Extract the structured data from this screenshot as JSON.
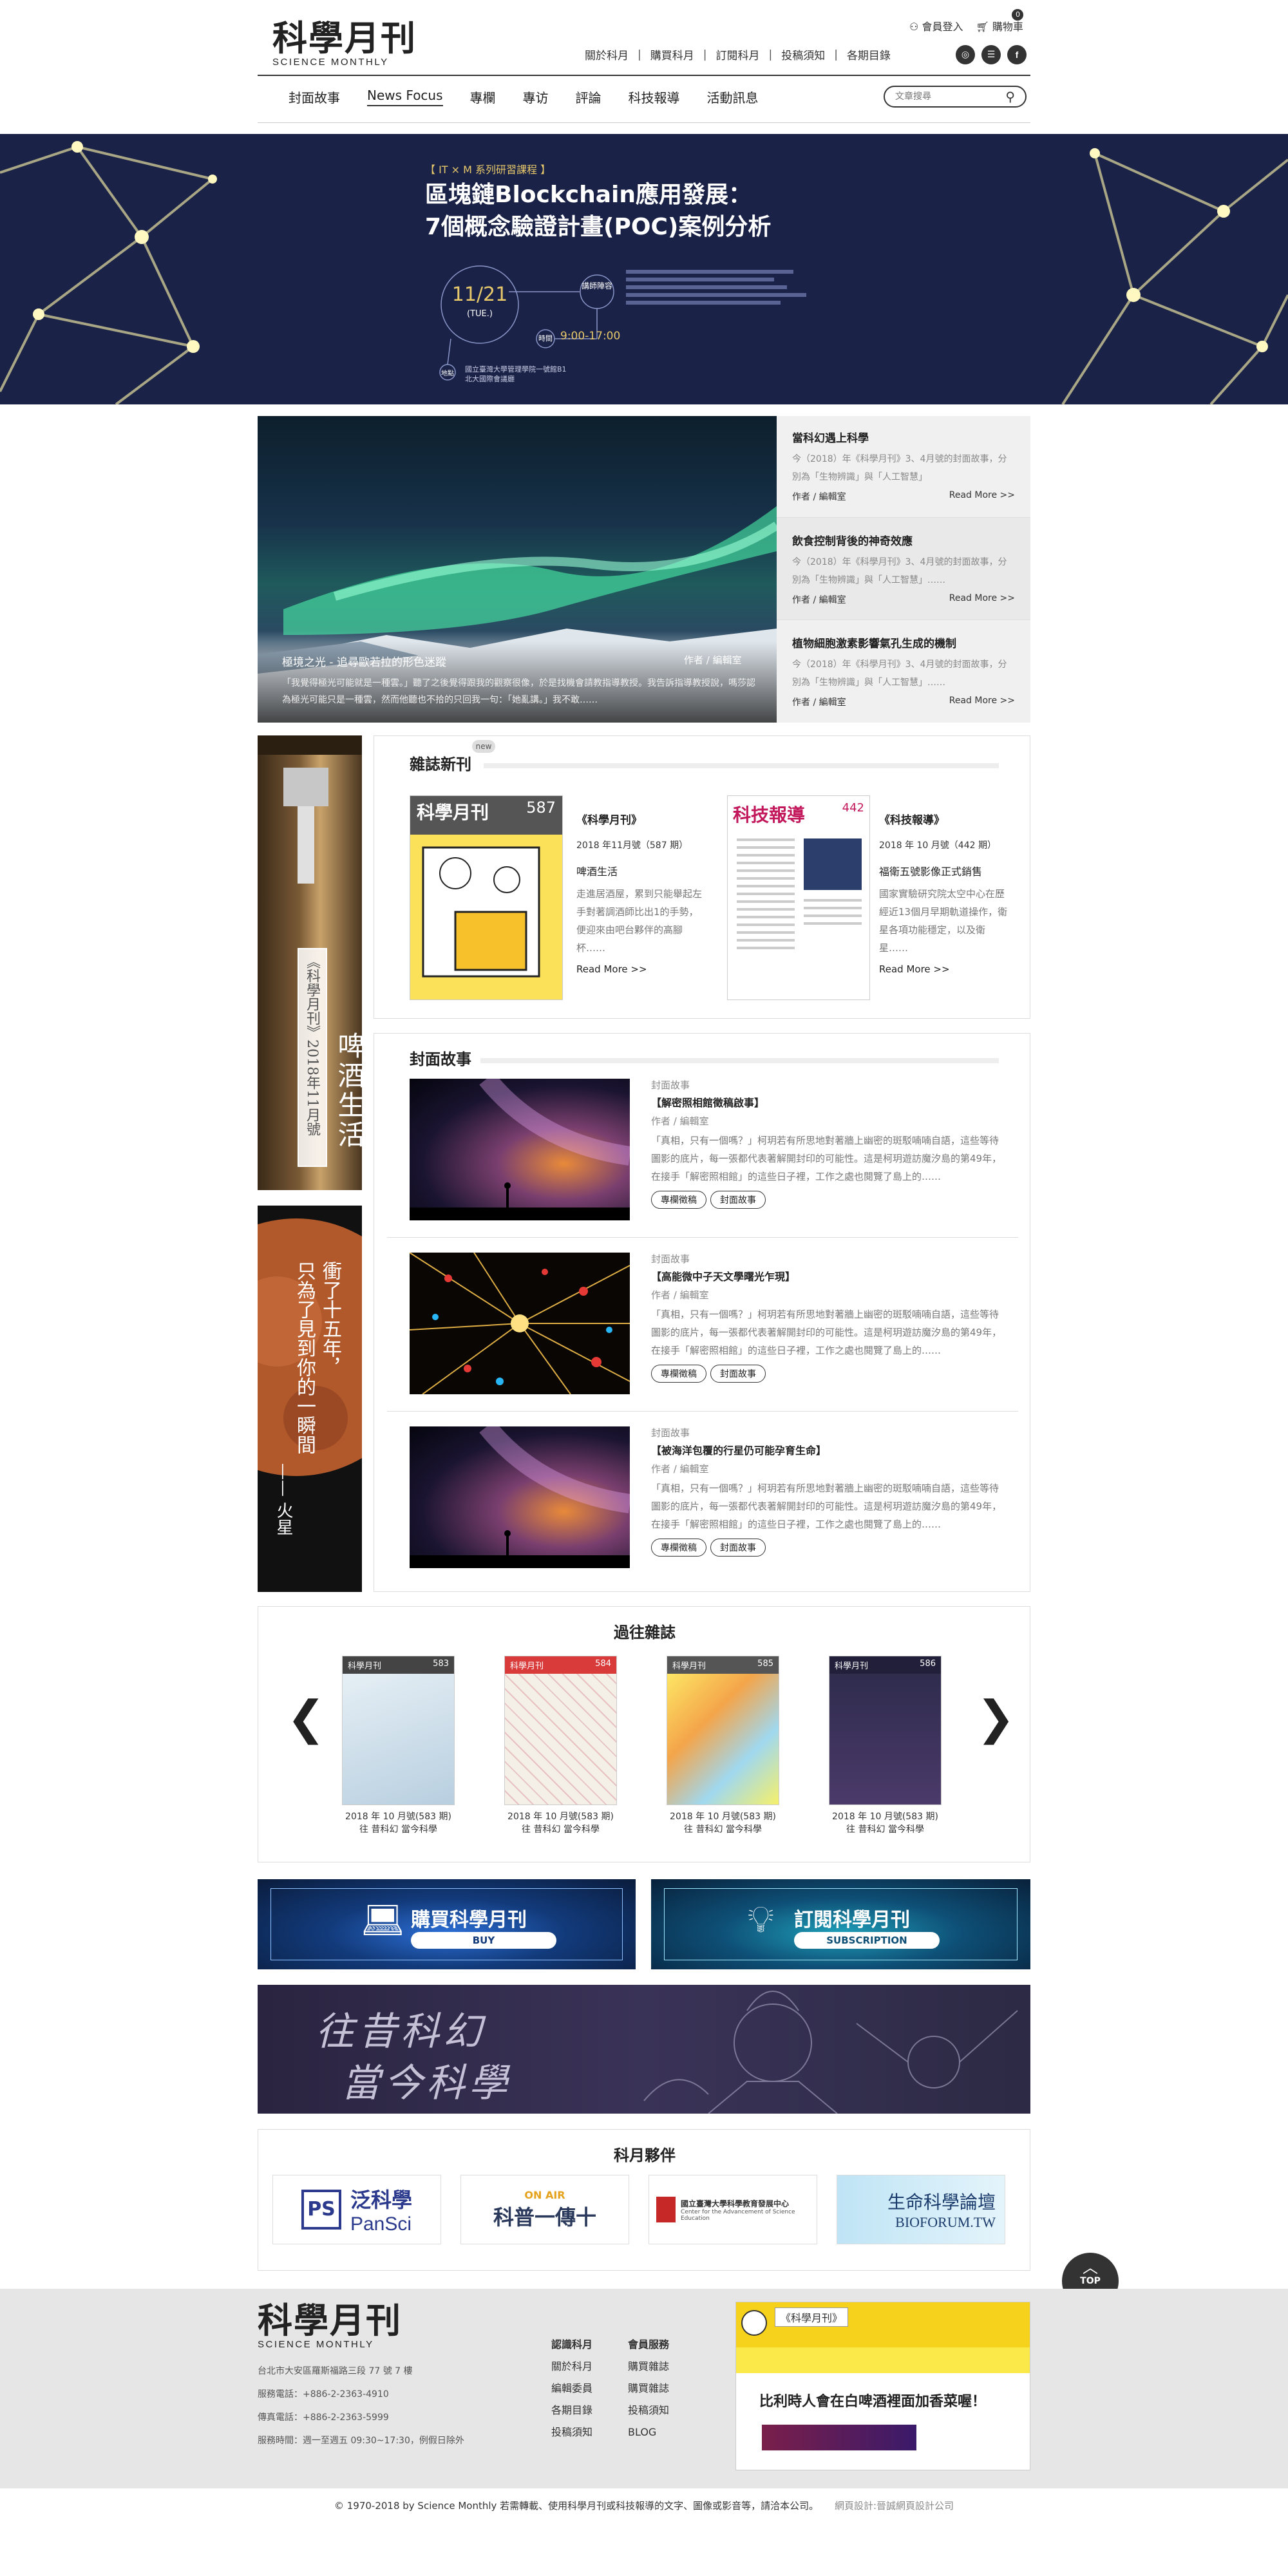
{
  "header": {
    "logo_zh": "科學月刊",
    "logo_en": "SCIENCE MONTHLY",
    "login": "會員登入",
    "cart": "購物車",
    "cart_count": "0",
    "top_links": [
      "關於科月",
      "購買科月",
      "訂閱科月",
      "投稿須知",
      "各期目錄"
    ],
    "nav": [
      "封面故事",
      "News Focus",
      "專欄",
      "專访",
      "評論",
      "科技報導",
      "活動訊息"
    ],
    "search_placeholder": "文章搜尋"
  },
  "hero": {
    "badge": "【 IT × M 系列研習課程 】",
    "line1": "區塊鏈Blockchain應用發展：",
    "line2": "7個概念驗證計畫(POC)案例分析",
    "date_md": "11/21",
    "date_dow": "(TUE.)",
    "speaker_label": "講師陣容",
    "time_label": "時間",
    "time": "9:00-17:00",
    "place_label": "地點",
    "place": "國立臺灣大學管理學院一號館B1 北大國際會議廳"
  },
  "feature": {
    "title": "極境之光 - 追尋歐若拉的形色迷蹤",
    "author": "作者 / 編輯室",
    "excerpt": "「我覺得極光可能就是一種雲。」聽了之後覺得跟我的觀察很像，於是找機會請教指導教授。我告訴指導教授說，嗎莎認為極光可能只是一種雲，然而他聽也不拾的只回我一句：「她亂講。」我不敢……",
    "side": [
      {
        "title": "當科幻遇上科學",
        "text": "今（2018）年《科學月刊》3、4月號的封面故事，分別為「生物辨識」與「人工智慧」",
        "author": "作者 / 編輯室",
        "more": "Read More >>"
      },
      {
        "title": "飲食控制背後的神奇效應",
        "text": "今（2018）年《科學月刊》3、4月號的封面故事，分別為「生物辨識」與「人工智慧」……",
        "author": "作者 / 編輯室",
        "more": "Read More >>"
      },
      {
        "title": "植物細胞激素影響氣孔生成的機制",
        "text": "今（2018）年《科學月刊》3、4月號的封面故事，分別為「生物辨識」與「人工智慧」……",
        "author": "作者 / 編輯室",
        "more": "Read More >>"
      }
    ]
  },
  "side_banners": {
    "beer_title": "啤酒生活",
    "beer_sub": "《科學月刊》2018年11月號",
    "mars_line1": "衝了十五年，",
    "mars_line2": "只為了見到你的一瞬間",
    "mars_sign": "—— 火星"
  },
  "new_issue": {
    "title": "雜誌新刊",
    "badge": "new",
    "items": [
      {
        "mag": "《科學月刊》",
        "cover_title": "科學月刊",
        "cover_no": "587",
        "issue": "2018 年11月號（587 期）",
        "topic": "啤酒生活",
        "desc": "走進居酒屋，累到只能舉起左手對著調酒師比出1的手勢，便迎來由吧台夥伴的高腳杯……",
        "more": "Read More >>"
      },
      {
        "mag": "《科技報導》",
        "cover_title": "科技報導",
        "cover_no": "442",
        "issue": "2018 年 10 月號（442 期）",
        "topic": "福衛五號影像正式銷售",
        "desc": "國家實驗研究院太空中心在歷經近13個月早期軌道操作，衛星各項功能穩定，以及衛星……",
        "more": "Read More >>"
      }
    ]
  },
  "cover_story": {
    "title": "封面故事",
    "items": [
      {
        "cat": "封面故事",
        "title": "【解密照相館徵稿啟事】",
        "author": "作者 / 編輯室",
        "text": "「真相，只有一個嗎？」柯玥若有所思地對著牆上幽密的斑駁喃喃自語，這些等待圖影的底片，每一張都代表著解開封印的可能性。這是柯玥遊訪魔汐島的第49年，在接手「解密照相館」的這些日子裡，工作之處也閱覽了島上的……",
        "tags": [
          "專欄徵稿",
          "封面故事"
        ]
      },
      {
        "cat": "封面故事",
        "title": "【高能微中子天文學曙光乍現】",
        "author": "作者 / 編輯室",
        "text": "「真相，只有一個嗎？」柯玥若有所思地對著牆上幽密的斑駁喃喃自語，這些等待圖影的底片，每一張都代表著解開封印的可能性。這是柯玥遊訪魔汐島的第49年，在接手「解密照相館」的這些日子裡，工作之處也閱覽了島上的……",
        "tags": [
          "專欄徵稿",
          "封面故事"
        ]
      },
      {
        "cat": "封面故事",
        "title": "【被海洋包覆的行星仍可能孕育生命】",
        "author": "作者 / 編輯室",
        "text": "「真相，只有一個嗎？」柯玥若有所思地對著牆上幽密的斑駁喃喃自語，這些等待圖影的底片，每一張都代表著解開封印的可能性。這是柯玥遊訪魔汐島的第49年，在接手「解密照相館」的這些日子裡，工作之處也閱覽了島上的……",
        "tags": [
          "專欄徵稿",
          "封面故事"
        ]
      }
    ]
  },
  "past_issues": {
    "title": "過往雜誌",
    "prev": "❮",
    "next": "❯",
    "items": [
      {
        "no": "583",
        "line1": "2018 年 10 月號(583 期)",
        "line2": "往 昔科幻 當今科學"
      },
      {
        "no": "584",
        "line1": "2018 年 10 月號(583 期)",
        "line2": "往 昔科幻 當今科學"
      },
      {
        "no": "585",
        "line1": "2018 年 10 月號(583 期)",
        "line2": "往 昔科幻 當今科學"
      },
      {
        "no": "586",
        "line1": "2018 年 10 月號(583 期)",
        "line2": "往 昔科幻 當今科學"
      }
    ]
  },
  "promo": {
    "buy_zh": "購買科學月刊",
    "buy_en": "BUY",
    "sub_zh": "訂閱科學月刊",
    "sub_en": "SUBSCRIPTION",
    "banner_line1": "往昔科幻",
    "banner_line2": "當今科學"
  },
  "partners": {
    "title": "科月夥伴",
    "items": [
      {
        "zh": "泛科學",
        "en": "PanSci",
        "mark": "PS"
      },
      {
        "zh": "科普一傳十",
        "en": "ON AIR",
        "mark": ""
      },
      {
        "zh": "國立臺灣大學科學教育發展中心",
        "en": "Center for the Advancement of Science Education",
        "mark": ""
      },
      {
        "zh": "生命科學論壇",
        "en": "BIOFORUM.TW",
        "mark": ""
      }
    ]
  },
  "top_button": "TOP",
  "footer": {
    "address": "台北市大安區羅斯福路三段 77 號 7 樓",
    "phone": "服務電話：+886-2-2363-4910",
    "fax": "傳真電話：+886-2-2363-5999",
    "hours": "服務時間：週一至週五 09:30~17:30，例假日除外",
    "col1": [
      "認識科月",
      "關於科月",
      "編輯委員",
      "各期目錄",
      "投稿須知"
    ],
    "col2": [
      "會員服務",
      "購買雜誌",
      "購買雜誌",
      "投稿須知",
      "BLOG"
    ],
    "fb_widget": "《科學月刊》",
    "fb_headline": "比利時人會在白啤酒裡面加香菜喔！",
    "copyright": "© 1970-2018 by Science Monthly  若需轉載、使用科學月刊或科技報導的文字、圖像或影音等，請洽本公司。",
    "design": "網頁設計:晉誠網頁設計公司"
  },
  "colors": {
    "hero_bg": "#1a2247",
    "footer_bg": "#e6e6e6",
    "accent_line": "#eeeeee"
  }
}
